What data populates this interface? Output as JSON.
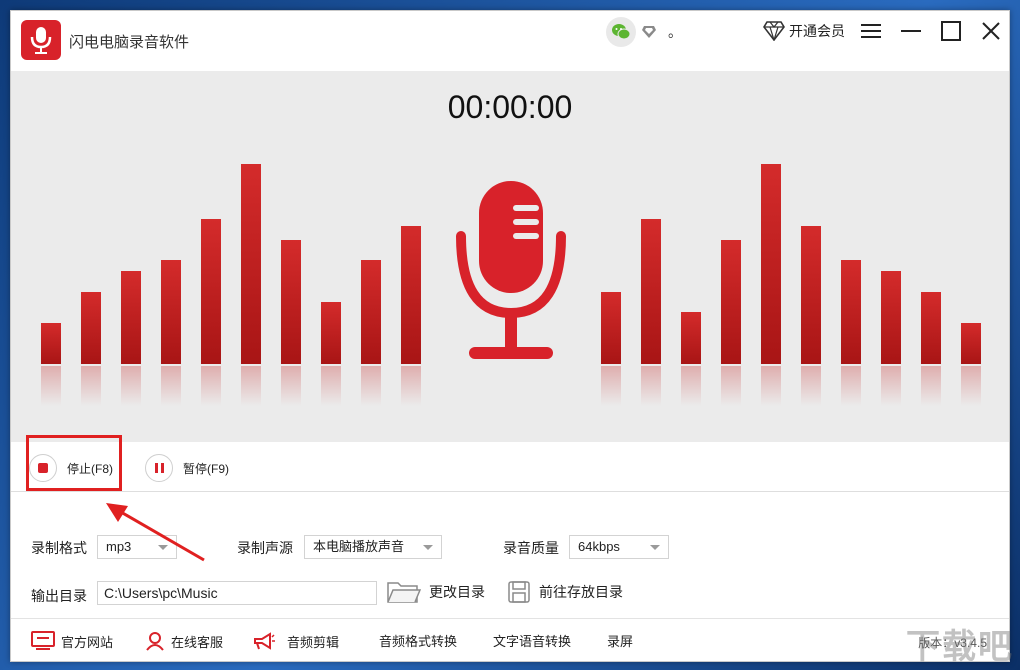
{
  "window": {
    "title": "闪电电脑录音软件",
    "user_name": "。",
    "vip_label": "开通会员"
  },
  "recorder": {
    "timer": "00:00:00"
  },
  "controls": {
    "stop_label": "停止(F8)",
    "pause_label": "暂停(F9)"
  },
  "settings": {
    "format_label": "录制格式",
    "format_value": "mp3",
    "source_label": "录制声源",
    "source_value": "本电脑播放声音",
    "quality_label": "录音质量",
    "quality_value": "64kbps",
    "output_label": "输出目录",
    "output_value": "C:\\Users\\pc\\Music",
    "change_dir_label": "更改目录",
    "open_dir_label": "前往存放目录"
  },
  "footer": {
    "items": [
      "官方网站",
      "在线客服",
      "音频剪辑",
      "音频格式转换",
      "文字语音转换",
      "录屏"
    ],
    "version": "版本：v3.4.5"
  },
  "colors": {
    "accent": "#d8222a",
    "bar_top": "#d42b2b",
    "bar_bottom": "#a81515",
    "stage_bg": "#ebebeb",
    "annotation": "#e02020"
  },
  "watermark": "下载吧"
}
